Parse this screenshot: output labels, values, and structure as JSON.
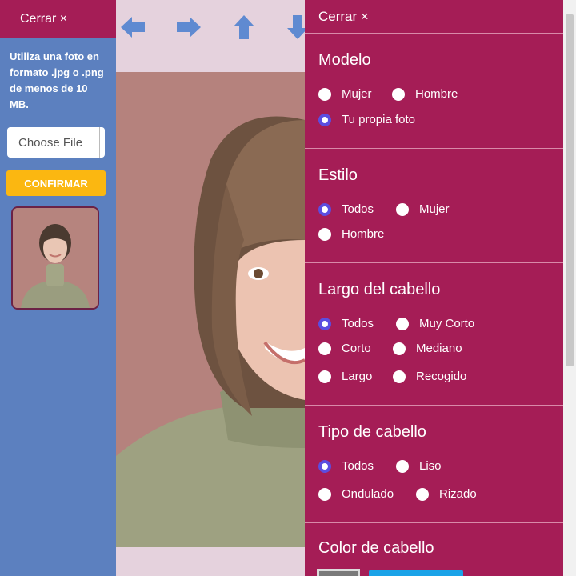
{
  "left_panel": {
    "close_label": "Cerrar ×",
    "upload_text": "Utiliza una foto en formato .jpg o .png de menos de 10 MB.",
    "file_button_label": "Choose File",
    "confirm_label": "CONFIRMAR"
  },
  "right_panel": {
    "close_label": "Cerrar ×",
    "sections": [
      {
        "title": "Modelo",
        "options": [
          {
            "label": "Mujer",
            "checked": false
          },
          {
            "label": "Hombre",
            "checked": false
          },
          {
            "label": "Tu propia foto",
            "checked": true
          }
        ]
      },
      {
        "title": "Estilo",
        "options": [
          {
            "label": "Todos",
            "checked": true
          },
          {
            "label": "Mujer",
            "checked": false
          },
          {
            "label": "Hombre",
            "checked": false
          }
        ]
      },
      {
        "title": "Largo del cabello",
        "options": [
          {
            "label": "Todos",
            "checked": true
          },
          {
            "label": "Muy Corto",
            "checked": false
          },
          {
            "label": "Corto",
            "checked": false
          },
          {
            "label": "Mediano",
            "checked": false
          },
          {
            "label": "Largo",
            "checked": false
          },
          {
            "label": "Recogido",
            "checked": false
          }
        ]
      },
      {
        "title": "Tipo de cabello",
        "options": [
          {
            "label": "Todos",
            "checked": true
          },
          {
            "label": "Liso",
            "checked": false
          },
          {
            "label": "Ondulado",
            "checked": false
          },
          {
            "label": "Rizado",
            "checked": false
          }
        ]
      },
      {
        "title": "Color de cabello",
        "options": []
      }
    ]
  },
  "icons": [
    "arrow-left-icon",
    "arrow-right-icon",
    "arrow-up-icon",
    "arrow-down-icon"
  ],
  "colors": {
    "accent": "#a51d56",
    "left_panel": "#5c80bf",
    "confirm": "#fbb711",
    "radio_checked": "#5b4de0",
    "arrow": "#5f8ad1"
  }
}
